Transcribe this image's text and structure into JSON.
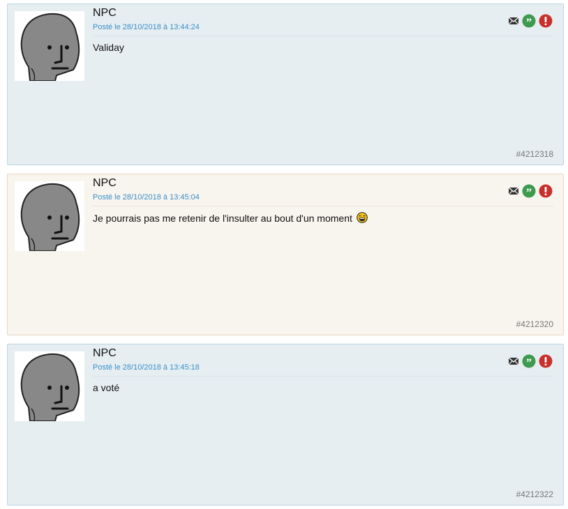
{
  "posts": [
    {
      "author": "NPC",
      "date": "Posté le 28/10/2018 à 13:44:24",
      "content": "Validay",
      "number": "#4212318",
      "has_smiley": false
    },
    {
      "author": "NPC",
      "date": "Posté le 28/10/2018 à 13:45:04",
      "content": "Je pourrais pas me retenir de l'insulter au bout d'un moment",
      "number": "#4212320",
      "has_smiley": true
    },
    {
      "author": "NPC",
      "date": "Posté le 28/10/2018 à 13:45:18",
      "content": "a voté",
      "number": "#4212322",
      "has_smiley": false
    }
  ],
  "icons": {
    "message": "envelope-icon",
    "quote": "quote-icon",
    "report": "exclamation-icon",
    "smiley": "laughing-smiley-icon"
  },
  "colors": {
    "post_bg_blue": "#e6eef2",
    "post_bg_cream": "#f8f4ee",
    "date_blue": "#3a8fc8",
    "quote_green": "#3e9a4f",
    "report_red": "#c8302c"
  }
}
